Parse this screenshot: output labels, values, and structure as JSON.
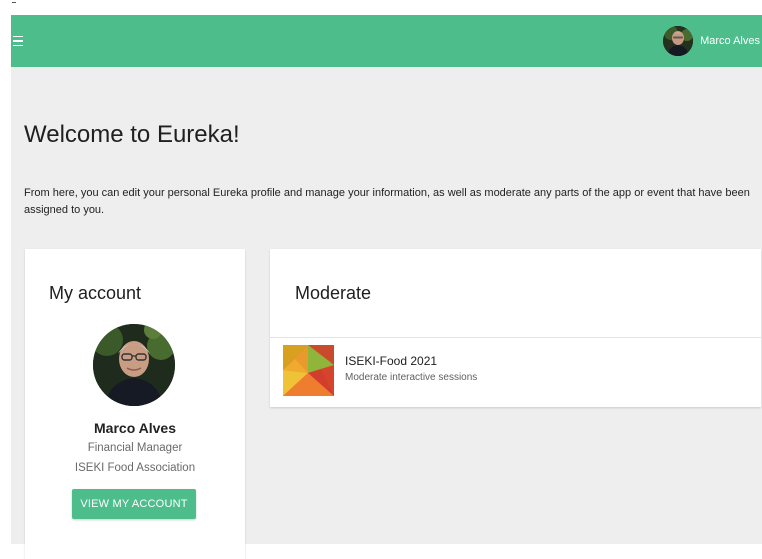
{
  "header": {
    "menu_icon": "hamburger-menu-icon",
    "user": {
      "name": "Marco Alves",
      "avatar": "user-avatar"
    }
  },
  "welcome": {
    "title": "Welcome to Eureka!",
    "description": "From here, you can edit your personal Eureka profile and manage your information, as well as moderate any parts of the app or event that have been assigned to you."
  },
  "account_card": {
    "title": "My account",
    "name": "Marco Alves",
    "role": "Financial Manager",
    "organization": "ISEKI Food Association",
    "button_label": "VIEW MY ACCOUNT"
  },
  "moderate_card": {
    "title": "Moderate",
    "items": [
      {
        "name": "ISEKI-Food 2021",
        "subtitle": "Moderate interactive sessions"
      }
    ]
  },
  "colors": {
    "accent": "#4dbd8b",
    "background": "#eeeeee",
    "card": "#ffffff"
  }
}
